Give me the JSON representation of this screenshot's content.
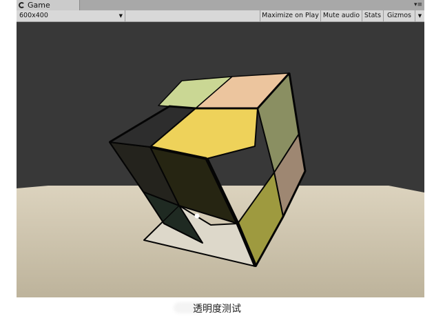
{
  "window": {
    "tab_title": "Game"
  },
  "toolbar": {
    "resolution": "600x400",
    "maximize_label": "Maximize on Play",
    "mute_label": "Mute audio",
    "stats_label": "Stats",
    "gizmos_label": "Gizmos"
  },
  "icons": {
    "tab": "game-controller-icon",
    "menu": "panel-menu-icon",
    "dropdown": "chevron-down-icon"
  },
  "colors": {
    "sky": "#383838",
    "floor": "#cfc5ad",
    "face_yellow": "#eed25a",
    "face_green": "#cad794",
    "face_orange": "#ecc59e",
    "face_olive": "#8a8f62",
    "face_brown": "#9e8772"
  },
  "caption": "透明度测试"
}
